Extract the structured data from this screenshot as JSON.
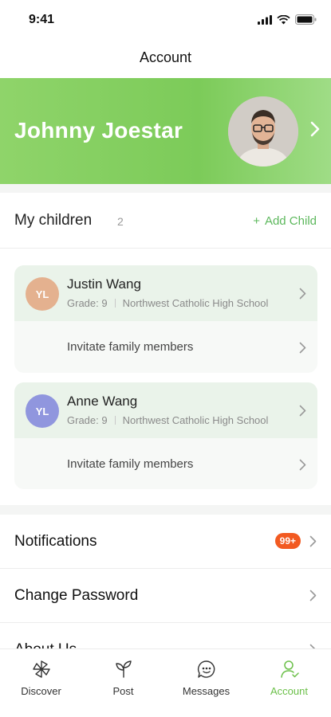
{
  "status_bar": {
    "time": "9:41"
  },
  "header": {
    "title": "Account"
  },
  "profile": {
    "name": "Johnny Joestar"
  },
  "children_section": {
    "title": "My children",
    "count": "2",
    "add_label": "Add Child",
    "add_icon": "plus-icon"
  },
  "children": [
    {
      "initials": "YL",
      "avatar_color": "#e4b18f",
      "name": "Justin Wang",
      "grade": "Grade: 9",
      "school": "Northwest Catholic High School",
      "invite_label": "Invitate family members"
    },
    {
      "initials": "YL",
      "avatar_color": "#9096de",
      "name": "Anne Wang",
      "grade": "Grade: 9",
      "school": "Northwest Catholic High School",
      "invite_label": "Invitate family members"
    }
  ],
  "menu": [
    {
      "label": "Notifications",
      "badge": "99+"
    },
    {
      "label": "Change Password"
    },
    {
      "label": "About Us"
    }
  ],
  "tabs": [
    {
      "label": "Discover",
      "icon": "pinwheel-icon"
    },
    {
      "label": "Post",
      "icon": "sprout-icon"
    },
    {
      "label": "Messages",
      "icon": "chat-icon"
    },
    {
      "label": "Account",
      "icon": "user-icon",
      "active": true
    }
  ],
  "colors": {
    "brand_green": "#7ccb59",
    "accent_green": "#5cb85c",
    "badge_orange": "#f25a21"
  }
}
